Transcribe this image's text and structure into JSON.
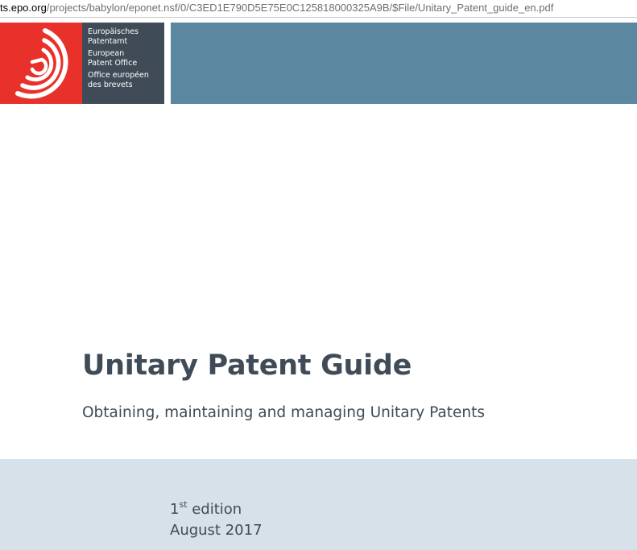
{
  "address_bar": {
    "domain": "ts.epo.org",
    "path": "/projects/babylon/eponet.nsf/0/C3ED1E790D5E75E0C125818000325A9B/$File/Unitary_Patent_guide_en.pdf"
  },
  "logo": {
    "icon": "epo-logo-icon",
    "lines_de": [
      "Europäisches",
      "Patentamt"
    ],
    "lines_en": [
      "European",
      "Patent Office"
    ],
    "lines_fr": [
      "Office européen",
      "des brevets"
    ]
  },
  "document": {
    "title": "Unitary Patent Guide",
    "subtitle": "Obtaining, maintaining and managing Unitary Patents",
    "edition_number": "1",
    "edition_suffix": "st",
    "edition_label": " edition",
    "date": "August 2017"
  },
  "colors": {
    "logo_red": "#e8312a",
    "logo_dark": "#3f4b56",
    "banner_blue": "#5b87a0",
    "footer_band": "#d6e1ea",
    "text": "#3f4b56"
  }
}
